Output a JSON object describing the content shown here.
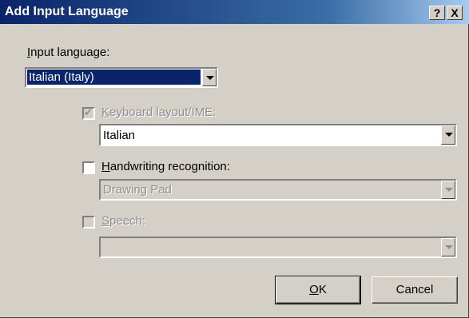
{
  "window": {
    "title": "Add Input Language",
    "help_label": "?",
    "close_label": "X"
  },
  "input_language": {
    "label": "Input language:",
    "value": "Italian (Italy)"
  },
  "keyboard_layout": {
    "label": "Keyboard layout/IME:",
    "checked": true,
    "enabled": false,
    "value": "Italian"
  },
  "handwriting": {
    "label": "Handwriting recognition:",
    "checked": false,
    "enabled": true,
    "value": "Drawing Pad"
  },
  "speech": {
    "label": "Speech:",
    "checked": false,
    "enabled": false,
    "value": ""
  },
  "buttons": {
    "ok": "OK",
    "cancel": "Cancel"
  },
  "colors": {
    "titlebar": "#0a246a",
    "face": "#d4d0c8",
    "selection": "#0a246a"
  },
  "icons": {
    "check": "check-mark-icon",
    "dropdown": "chevron-down-icon"
  }
}
